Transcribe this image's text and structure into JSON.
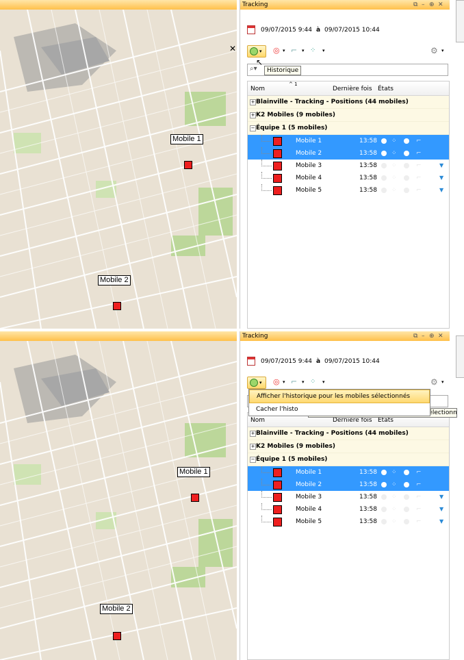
{
  "panel": {
    "title": "Tracking",
    "window_buttons": [
      "⧉",
      "–",
      "⊕",
      "✕"
    ],
    "date_from": "09/07/2015  9:44",
    "date_sep": "à",
    "date_to": "09/07/2015  10:44",
    "columns": {
      "name": "Nom",
      "last": "Dernière fois",
      "states": "États",
      "sort_mark": "^ 1"
    },
    "groups": [
      {
        "sign": "+",
        "label": "Blainville - Tracking - Positions (44 mobiles)"
      },
      {
        "sign": "+",
        "label": "K2 Mobiles (9 mobiles)"
      },
      {
        "sign": "−",
        "label": "Équipe 1 (5 mobiles)"
      }
    ],
    "mobiles": [
      {
        "name": "Mobile 1",
        "time": "13:58",
        "selected": true
      },
      {
        "name": "Mobile 2",
        "time": "13:58",
        "selected": true
      },
      {
        "name": "Mobile 3",
        "time": "13:58",
        "selected": false
      },
      {
        "name": "Mobile 4",
        "time": "13:58",
        "selected": false
      },
      {
        "name": "Mobile 5",
        "time": "13:58",
        "selected": false
      }
    ]
  },
  "top": {
    "tooltip": "Historique",
    "map_labels": [
      "Mobile 1",
      "Mobile 2"
    ]
  },
  "bottom": {
    "menu_items": [
      "Afficher l'historique pour les mobiles sélectionnés",
      "Cacher l'histo"
    ],
    "tooltip": "Afficher l'historique pour les mobiles sélectionnés",
    "map_labels": [
      "Mobile 1",
      "Mobile 2"
    ]
  },
  "colors": {
    "selection": "#3399ff",
    "marker": "#ee1f1f",
    "title_bar": "#ffc04a"
  }
}
